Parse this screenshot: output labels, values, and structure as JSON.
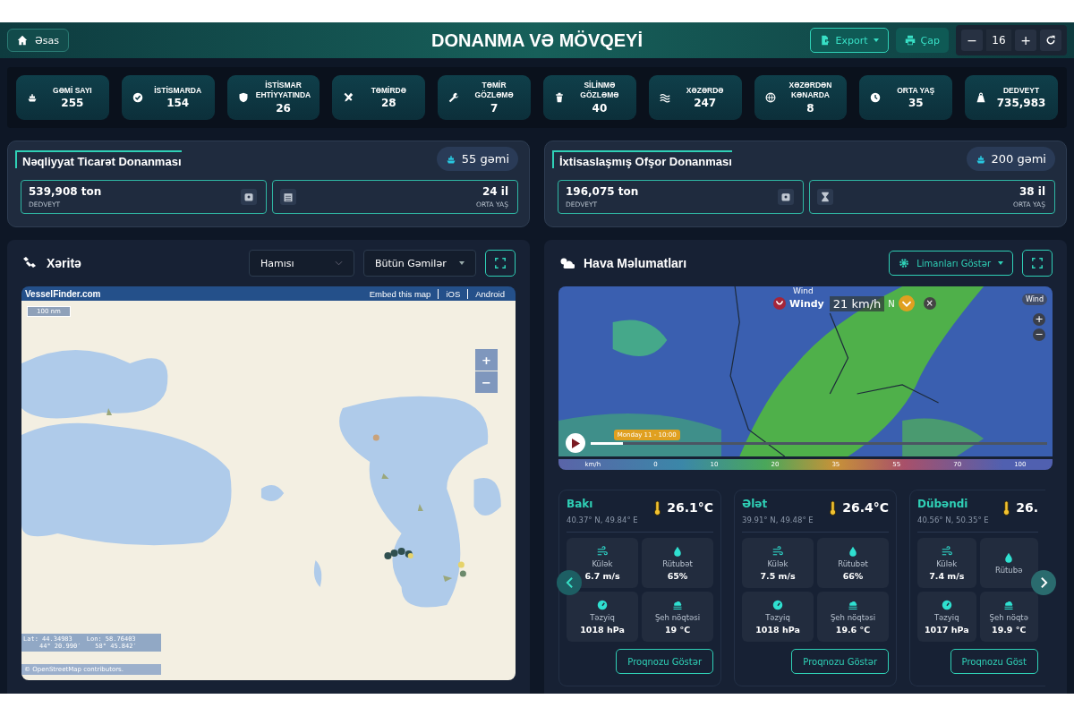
{
  "header": {
    "home": "Əsas",
    "title": "DONANMA VƏ MÖVQEYİ",
    "export": "Export",
    "print": "Çap",
    "zoom_out": "−",
    "zoom_value": "16",
    "zoom_in": "+"
  },
  "stats": [
    {
      "kind": "ship",
      "label": "GƏMİ SAYI",
      "value": "255"
    },
    {
      "kind": "check",
      "label": "İSTİSMARDA",
      "value": "154"
    },
    {
      "kind": "shield",
      "label": "İSTİSMAR EHTİYYATINDA",
      "value": "26"
    },
    {
      "kind": "tools",
      "label": "TƏMİRDƏ",
      "value": "28"
    },
    {
      "kind": "wrench",
      "label": "TƏMİR GÖZLƏMƏ",
      "value": "7"
    },
    {
      "kind": "trash",
      "label": "SİLİNMƏ GÖZLƏMƏ",
      "value": "40"
    },
    {
      "kind": "water",
      "label": "XƏZƏRDƏ",
      "value": "247"
    },
    {
      "kind": "globe",
      "label": "XƏZƏRDƏN KƏNARDA",
      "value": "8"
    },
    {
      "kind": "clock",
      "label": "ORTA YAŞ",
      "value": "35"
    },
    {
      "kind": "weight",
      "label": "DEDVEYT",
      "value": "735,983"
    }
  ],
  "fleets": [
    {
      "title": "Nəqliyyat Ticarət Donanması",
      "count": "55 gəmi",
      "tonnage": {
        "value": "539,908 ton",
        "label": "DEDVEYT"
      },
      "age": {
        "value": "24 il",
        "label": "ORTA YAŞ",
        "kind": "calendar"
      }
    },
    {
      "title": "İxtisaslaşmış Ofşor Donanması",
      "count": "200 gəmi",
      "tonnage": {
        "value": "196,075 ton",
        "label": "DEDVEYT"
      },
      "age": {
        "value": "38 il",
        "label": "ORTA YAŞ",
        "kind": "hourglass"
      }
    }
  ],
  "map_panel": {
    "title": "Xəritə",
    "filter_1": "Hamısı",
    "filter_2": "Bütün Gəmilər",
    "map": {
      "brand": "VesselFinder.com",
      "links": [
        "Embed this map",
        "iOS",
        "Android"
      ],
      "scale": "100 nm",
      "zoom_in": "+",
      "zoom_out": "−",
      "lat": "Lat: 44.34983",
      "lon": "Lon: 58.76403",
      "lat_dms": "44° 20.990′",
      "lon_dms": "58° 45.842′",
      "attribution": "© OpenStreetMap contributors."
    }
  },
  "weather_panel": {
    "title": "Hava Məlumatları",
    "ports_button": "Limanları Göstər",
    "map": {
      "layer_label": "Wind",
      "logo": "Windy",
      "reading": "21 km/h",
      "direction": "N",
      "close": "×",
      "layer_toggle": "Wind",
      "zoom_in": "+",
      "zoom_out": "−",
      "time": "Monday 11 - 10:00",
      "level": 0.07,
      "legend": [
        "km/h",
        "0",
        "10",
        "20",
        "35",
        "55",
        "70",
        "100"
      ]
    },
    "stations": [
      {
        "name": "Bakı",
        "coords": "40.37° N, 49.84° E",
        "temp": "26.1°C",
        "metrics": [
          {
            "kind": "wind",
            "label": "Külək",
            "value": "6.7 m/s"
          },
          {
            "kind": "humidity",
            "label": "Rütubət",
            "value": "65%"
          },
          {
            "kind": "pressure",
            "label": "Təzyiq",
            "value": "1018 hPa"
          },
          {
            "kind": "dew",
            "label": "Şeh nöqtəsi",
            "value": "19 °C"
          }
        ],
        "button": "Proqnozu Göstər"
      },
      {
        "name": "Ələt",
        "coords": "39.91° N, 49.48° E",
        "temp": "26.4°C",
        "metrics": [
          {
            "kind": "wind",
            "label": "Külək",
            "value": "7.5 m/s"
          },
          {
            "kind": "humidity",
            "label": "Rütubət",
            "value": "66%"
          },
          {
            "kind": "pressure",
            "label": "Təzyiq",
            "value": "1018 hPa"
          },
          {
            "kind": "dew",
            "label": "Şeh nöqtəsi",
            "value": "19.6 °C"
          }
        ],
        "button": "Proqnozu Göstər"
      },
      {
        "name": "Dübəndi",
        "coords": "40.56° N, 50.35° E",
        "temp": "26.",
        "metrics": [
          {
            "kind": "wind",
            "label": "Külək",
            "value": "7.4 m/s"
          },
          {
            "kind": "humidity",
            "label": "Rütubə"
          },
          {
            "kind": "pressure",
            "label": "Təzyiq",
            "value": "1017 hPa"
          },
          {
            "kind": "dew",
            "label": "Şeh nöqtə",
            "value": "19.9 °C"
          }
        ],
        "button": "Proqnozu Göst"
      }
    ]
  }
}
